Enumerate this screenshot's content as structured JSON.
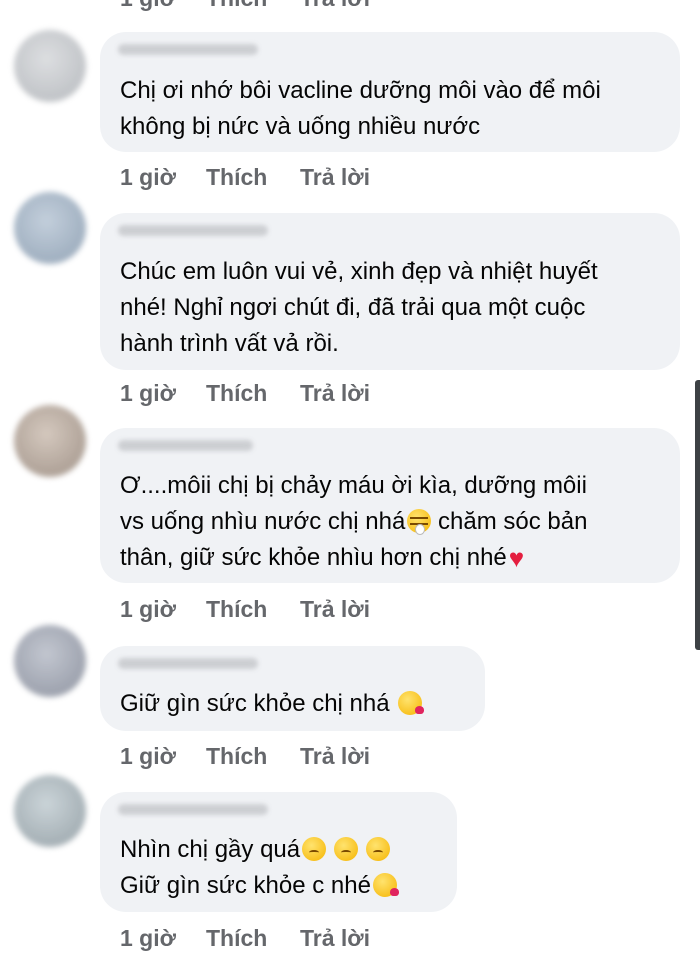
{
  "action_labels": {
    "time": "1 giờ",
    "like": "Thích",
    "reply": "Trả lời"
  },
  "comments": [
    {
      "lines": [
        "Chị ơi nhớ bôi vacline dưỡng môi vào để môi",
        "không bị nức và uống nhiều nước"
      ]
    },
    {
      "lines": [
        "Chúc em luôn vui vẻ, xinh đẹp và nhiệt huyết",
        "nhé! Nghỉ ngơi chút đi, đã trải qua một cuộc",
        "hành trình vất vả rồi."
      ]
    },
    {
      "lines": [
        "Ơ....môii chị bị chảy máu ời kìa, dưỡng môii",
        "vs uống nhìu nước chị nhá",
        " chăm sóc bản",
        "thân, giữ sức khỏe nhìu hơn chị nhé"
      ],
      "emojis": [
        "tears-of-pain-icon",
        "heart-icon"
      ]
    },
    {
      "lines": [
        "Giữ gìn sức khỏe chị nhá "
      ],
      "emojis": [
        "kiss-face-icon"
      ]
    },
    {
      "lines": [
        "Nhìn chị gầy quá",
        "Giữ gìn sức khỏe c nhé"
      ],
      "emojis": [
        "pensive-face-icon",
        "pensive-face-icon",
        "pensive-face-icon",
        "kiss-face-icon"
      ]
    }
  ],
  "colors": {
    "bubble": "#f0f2f5",
    "meta_text": "#65676b",
    "heart": "#e41e3f",
    "scrollbar": "#3d4145"
  }
}
